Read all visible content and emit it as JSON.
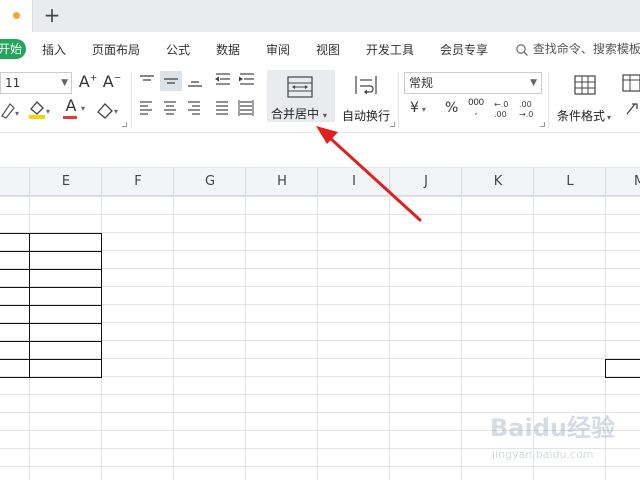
{
  "tabs": {
    "new_tab": "+"
  },
  "menu": {
    "start": "开始",
    "items": [
      "插入",
      "页面布局",
      "公式",
      "数据",
      "审阅",
      "视图",
      "开发工具",
      "会员专享"
    ],
    "search_text": "查找命令、搜索模板"
  },
  "ribbon": {
    "font_size": "11",
    "grow_font": "A",
    "shrink_font": "A",
    "font_color_letter": "A",
    "merge_label": "合并居中",
    "wrap_label": "自动换行",
    "number_format": "常规",
    "currency": "¥",
    "percent": "%",
    "thousands": "000",
    "cond_format_label": "条件格式"
  },
  "sheet": {
    "columns": [
      "E",
      "F",
      "G",
      "H",
      "I",
      "J",
      "K",
      "L",
      "M"
    ]
  },
  "watermark": {
    "brand": "Baidu经验",
    "url": "jingyan.baidu.com"
  },
  "colors": {
    "accent_green": "#22a65a",
    "arrow_red": "#e02020",
    "font_red": "#e53935",
    "fill_yellow": "#f5d400",
    "tab_dot": "#f2a33a"
  }
}
